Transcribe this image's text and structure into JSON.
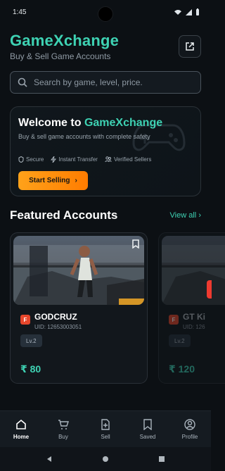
{
  "status": {
    "time": "1:45",
    "icons": [
      "wifi-icon",
      "signal-icon",
      "battery-icon"
    ]
  },
  "header": {
    "title": "GameXchange",
    "subtitle": "Buy & Sell Game Accounts"
  },
  "search": {
    "placeholder": "Search by game, level, price."
  },
  "welcome": {
    "title_prefix": "Welcome to ",
    "title_accent": "GameXchange",
    "description": "Buy & sell game accounts with complete safety",
    "features": [
      "Secure",
      "Instant Transfer",
      "Verified Sellers"
    ],
    "button_label": "Start Selling"
  },
  "featured": {
    "title": "Featured Accounts",
    "view_all": "View all",
    "accounts": [
      {
        "initial": "F",
        "name": "GODCRUZ",
        "uid": "UID: 12653003051",
        "level": "Lv.2",
        "price": "₹ 80"
      },
      {
        "initial": "F",
        "name": "GT Ki",
        "uid": "UID: 126",
        "level": "Lv.2",
        "price": "₹ 120"
      }
    ]
  },
  "tabs": [
    "Home",
    "Buy",
    "Sell",
    "Saved",
    "Profile"
  ],
  "colors": {
    "accent": "#3ed2b3",
    "orange": "#ff8c08",
    "background": "#0c1014"
  }
}
